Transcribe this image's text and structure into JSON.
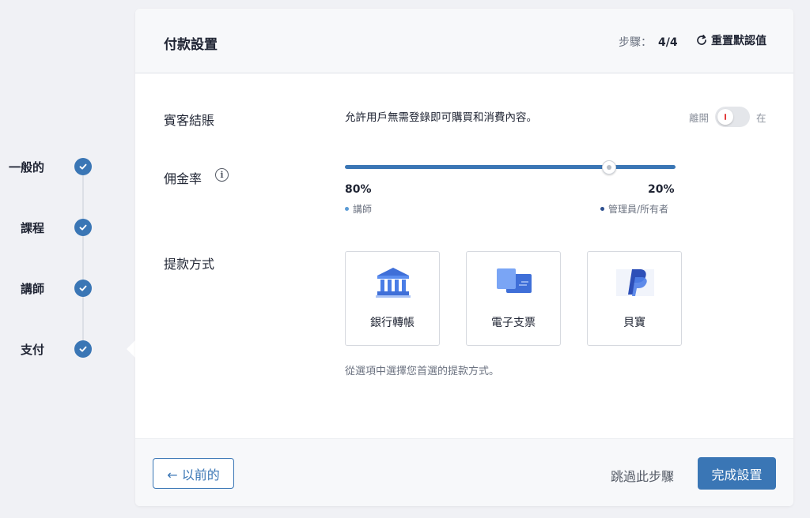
{
  "steps": [
    {
      "label": "一般的",
      "done": true
    },
    {
      "label": "課程",
      "done": true
    },
    {
      "label": "講師",
      "done": true
    },
    {
      "label": "支付",
      "done": true
    }
  ],
  "header": {
    "title": "付款設置",
    "step_prefix": "步驟：",
    "step_value": "4/4",
    "reset_label": "重置默認值"
  },
  "guest_checkout": {
    "label": "賓客結賬",
    "description": "允許用戶無需登錄即可購買和消費內容。",
    "toggle_off_label": "離開",
    "toggle_on_label": "在",
    "enabled": false
  },
  "commission": {
    "label": "佣金率",
    "instructor_percent": "80%",
    "admin_percent": "20%",
    "instructor_label": "講師",
    "admin_label": "管理員/所有者",
    "value": 0.8
  },
  "withdraw": {
    "label": "提款方式",
    "methods": [
      {
        "label": "銀行轉帳",
        "icon": "bank-icon"
      },
      {
        "label": "電子支票",
        "icon": "echeck-icon"
      },
      {
        "label": "貝寶",
        "icon": "paypal-icon"
      }
    ],
    "hint": "從選項中選擇您首選的提款方式。"
  },
  "footer": {
    "prev_label": "← 以前的",
    "skip_label": "跳過此步驟",
    "finish_label": "完成設置"
  },
  "colors": {
    "accent": "#3a76b5",
    "instructor_dot": "#5b9bd5",
    "admin_dot": "#2d4f8f",
    "toggle_off": "#e23b3b"
  }
}
